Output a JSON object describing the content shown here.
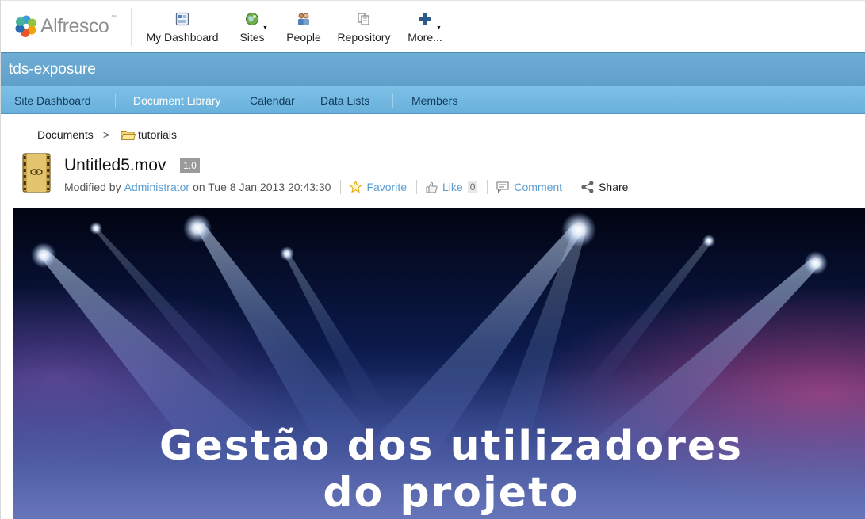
{
  "brand": {
    "name": "Alfresco",
    "tm": "™"
  },
  "app_nav": [
    {
      "label": "My Dashboard",
      "icon": "dashboard-icon"
    },
    {
      "label": "Sites",
      "icon": "sites-globe-icon",
      "has_caret": true
    },
    {
      "label": "People",
      "icon": "people-icon"
    },
    {
      "label": "Repository",
      "icon": "repository-icon"
    },
    {
      "label": "More...",
      "icon": "plus-icon",
      "has_caret": true
    }
  ],
  "site": {
    "title": "tds-exposure"
  },
  "site_nav": [
    {
      "label": "Site Dashboard",
      "active": false
    },
    {
      "label": "Document Library",
      "active": true
    },
    {
      "label": "Calendar",
      "active": false
    },
    {
      "label": "Data Lists",
      "active": false
    },
    {
      "label": "Members",
      "active": false
    }
  ],
  "breadcrumb": {
    "root": "Documents",
    "separator": ">",
    "folder": "tutoriais"
  },
  "document": {
    "name": "Untitled5.mov",
    "version": "1.0",
    "modified_prefix": "Modified by",
    "modifier": "Administrator",
    "modified_on": "on Tue 8 Jan 2013 20:43:30"
  },
  "actions": {
    "favorite": "Favorite",
    "like": "Like",
    "like_count": "0",
    "comment": "Comment",
    "share": "Share"
  },
  "preview": {
    "line1": "Gestão dos utilizadores",
    "line2": "do projeto"
  },
  "colors": {
    "site_title_bar": "#64a5cf",
    "site_nav": "#72b8e1",
    "link": "#5c9dd0"
  }
}
